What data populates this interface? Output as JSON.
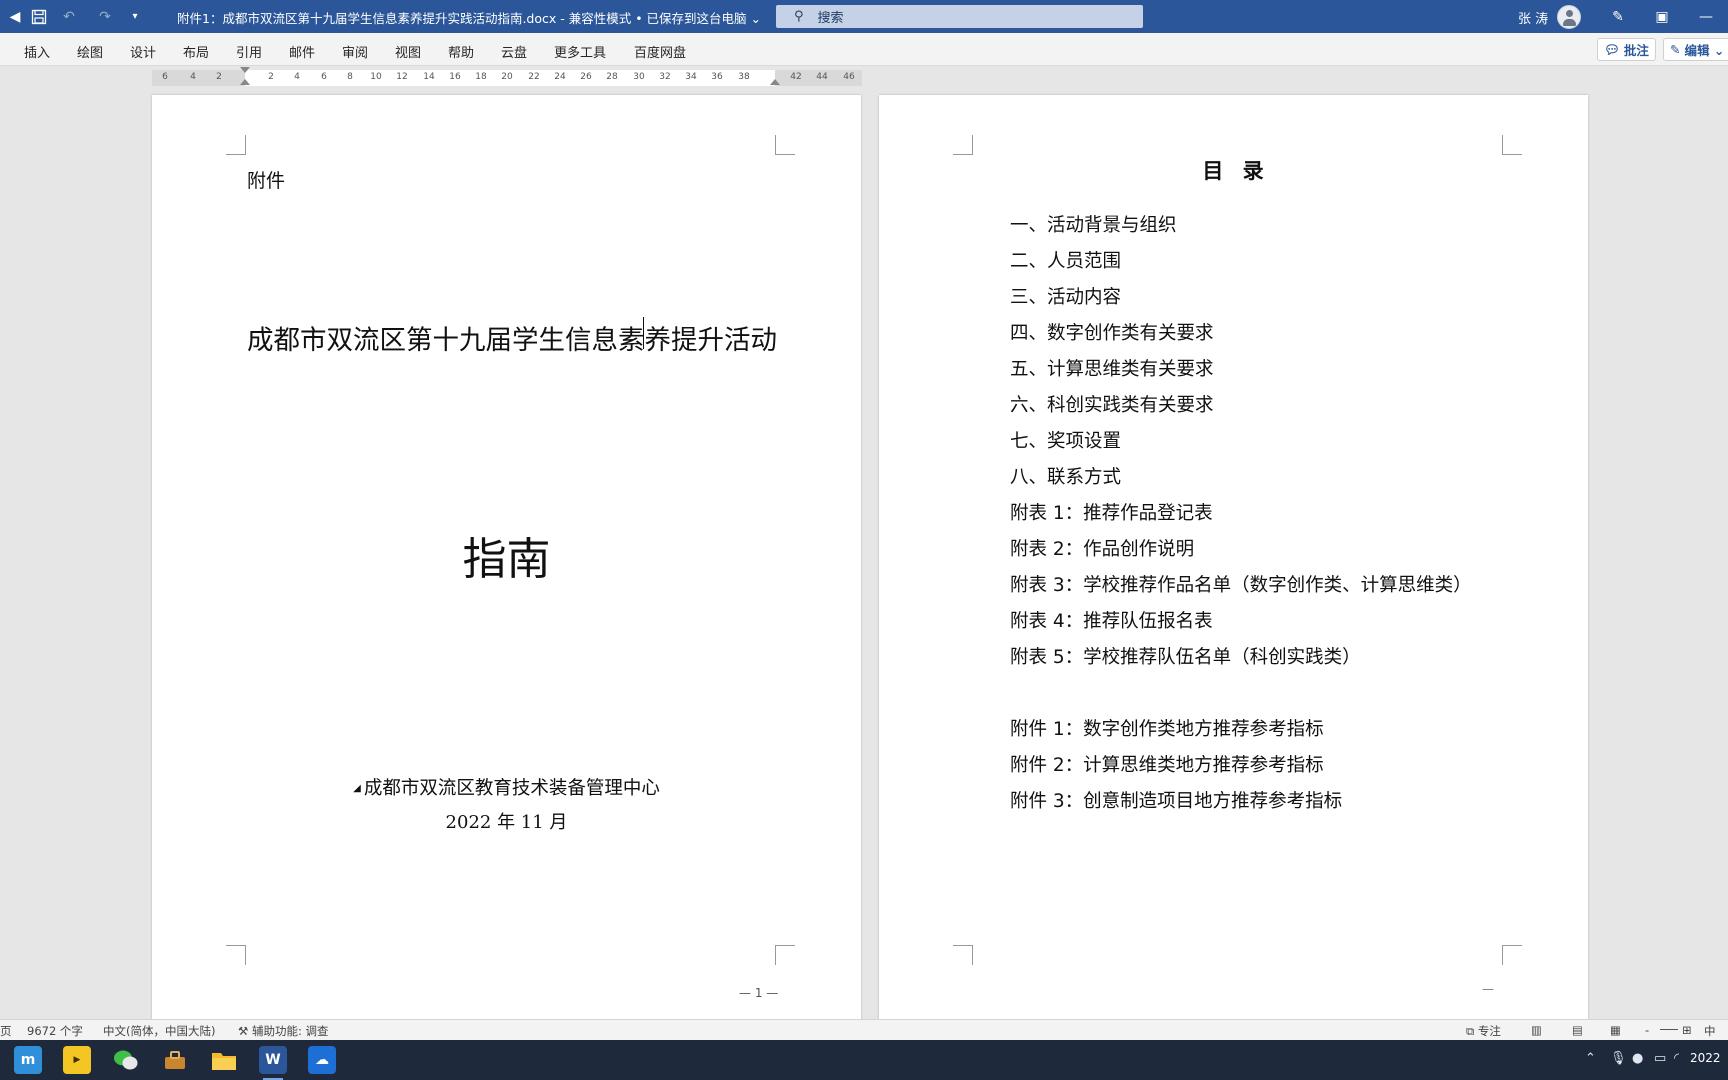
{
  "titlebar": {
    "doc_title": "附件1：成都市双流区第十九届学生信息素养提升实践活动指南.docx  -  兼容性模式 • 已保存到这台电脑 ⌄",
    "search_placeholder": "搜索",
    "user_name": "张 涛",
    "colors": {
      "bar": "#2b579a"
    }
  },
  "ribbon": {
    "tabs": [
      "插入",
      "绘图",
      "设计",
      "布局",
      "引用",
      "邮件",
      "审阅",
      "视图",
      "帮助",
      "云盘",
      "更多工具",
      "百度网盘"
    ],
    "comments_label": "批注",
    "editing_label": "编辑 ⌄"
  },
  "ruler": {
    "ticks": [
      "6",
      "4",
      "2",
      "2",
      "4",
      "6",
      "8",
      "10",
      "12",
      "14",
      "16",
      "18",
      "20",
      "22",
      "24",
      "26",
      "28",
      "30",
      "32",
      "34",
      "36",
      "38",
      "42",
      "44",
      "46"
    ]
  },
  "page1": {
    "attachment_label": "附件",
    "main_title": "成都市双流区第十九届学生信息素养提升活动",
    "guide": "指南",
    "organization": "成都市双流区教育技术装备管理中心",
    "date": "2022 年 11 月",
    "page_number": "— 1 —"
  },
  "page2": {
    "toc_title": "目 录",
    "toc_items": [
      "一、活动背景与组织",
      "二、人员范围",
      "三、活动内容",
      "四、数字创作类有关要求",
      "五、计算思维类有关要求",
      "六、科创实践类有关要求",
      "七、奖项设置",
      "八、联系方式",
      "附表 1：推荐作品登记表",
      "附表 2：作品创作说明",
      "附表 3：学校推荐作品名单（数字创作类、计算思维类）",
      "附表 4：推荐队伍报名表",
      "附表 5：学校推荐队伍名单（科创实践类）"
    ],
    "appendix_items": [
      "附件 1：数字创作类地方推荐参考指标",
      "附件 2：计算思维类地方推荐参考指标",
      "附件 3：创意制造项目地方推荐参考指标"
    ],
    "page_mark": "—"
  },
  "statusbar": {
    "page_indicator": "页",
    "word_count": "9672 个字",
    "language": "中文(简体，中国大陆)",
    "accessibility": "辅助功能: 调查",
    "focus": "专注",
    "zoom_minus": "-",
    "ime": "中"
  },
  "taskbar": {
    "apps": [
      "start-app",
      "player-app",
      "wechat-app",
      "toolbox-app",
      "file-explorer-app",
      "word-app",
      "cloud-app"
    ],
    "clock": "2022"
  }
}
